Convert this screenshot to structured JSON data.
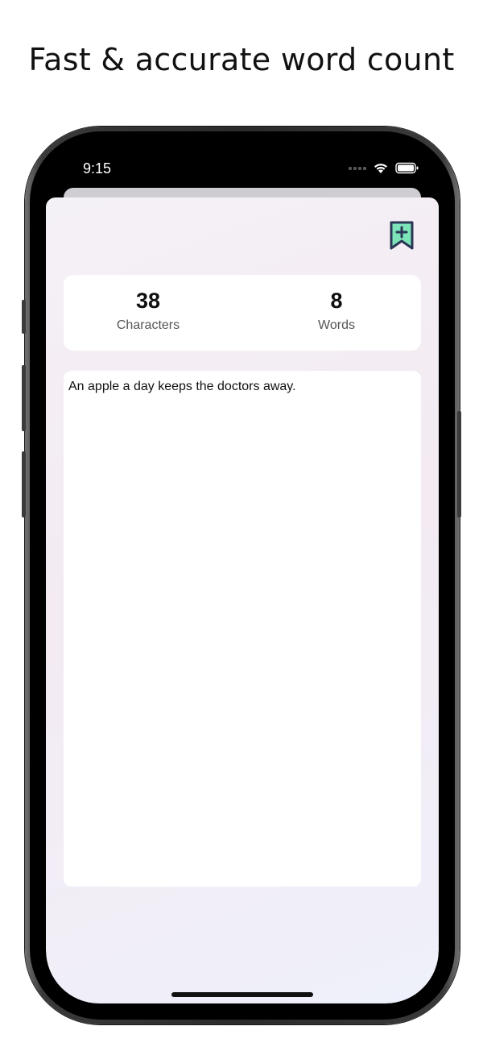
{
  "headline": "Fast & accurate word count",
  "status_bar": {
    "time": "9:15"
  },
  "stats": {
    "characters_value": "38",
    "characters_label": "Characters",
    "words_value": "8",
    "words_label": "Words"
  },
  "editor": {
    "text": "An apple a day keeps the doctors away."
  },
  "icons": {
    "bookmark": "bookmark-plus-icon",
    "wifi": "wifi-icon",
    "battery": "battery-icon"
  },
  "colors": {
    "bookmark_stroke": "#2b3555",
    "bookmark_fill": "#7de3b8"
  }
}
